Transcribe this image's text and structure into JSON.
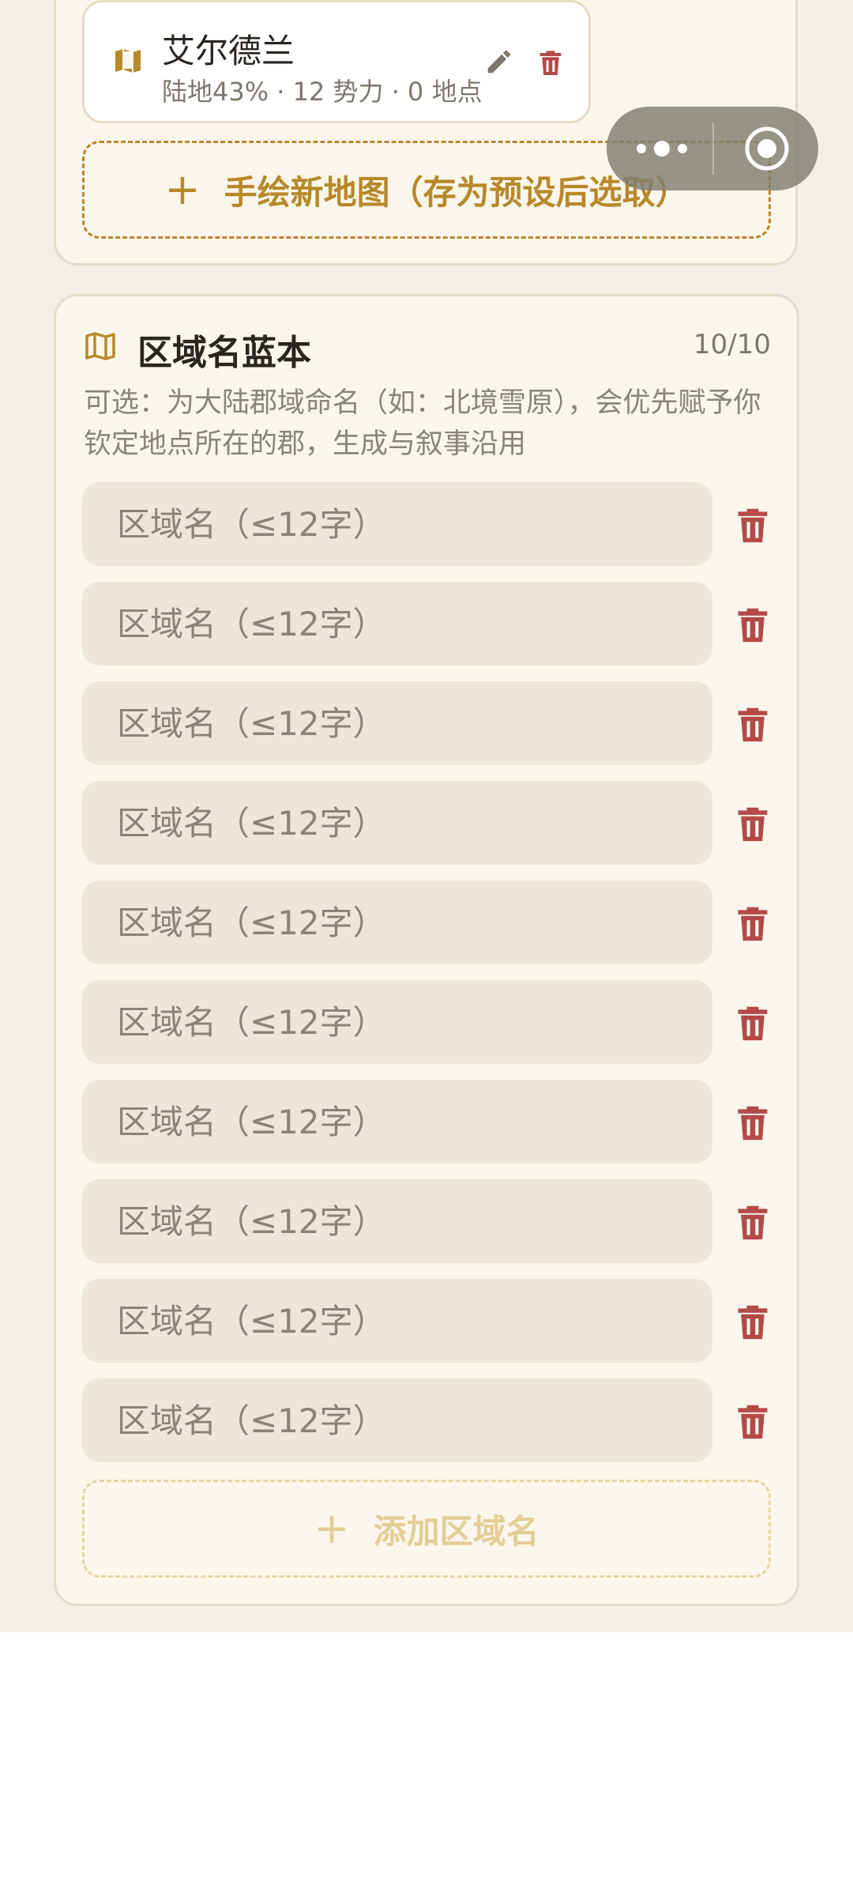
{
  "colors": {
    "accent": "#b8892a",
    "danger": "#b44a48",
    "card_bg": "#faf6ec",
    "input_bg": "#ede6da"
  },
  "map_item": {
    "icon": "map-icon",
    "name": "艾尔德兰",
    "meta": "陆地43% · 12 势力 · 0 地点",
    "edit_icon": "pencil-icon",
    "delete_icon": "trash-icon"
  },
  "draw_button": {
    "icon": "plus-icon",
    "label": "手绘新地图（存为预设后选取）"
  },
  "capsule": {
    "menu_icon": "more-dots-icon",
    "close_icon": "target-circle-icon"
  },
  "region_card": {
    "icon": "folded-map-icon",
    "title": "区域名蓝本",
    "count": "10/10",
    "description": "可选：为大陆郡域命名（如：北境雪原），会优先赋予你钦定地点所在的郡，生成与叙事沿用",
    "inputs": [
      {
        "value": "",
        "placeholder": "区域名（≤12字）"
      },
      {
        "value": "",
        "placeholder": "区域名（≤12字）"
      },
      {
        "value": "",
        "placeholder": "区域名（≤12字）"
      },
      {
        "value": "",
        "placeholder": "区域名（≤12字）"
      },
      {
        "value": "",
        "placeholder": "区域名（≤12字）"
      },
      {
        "value": "",
        "placeholder": "区域名（≤12字）"
      },
      {
        "value": "",
        "placeholder": "区域名（≤12字）"
      },
      {
        "value": "",
        "placeholder": "区域名（≤12字）"
      },
      {
        "value": "",
        "placeholder": "区域名（≤12字）"
      },
      {
        "value": "",
        "placeholder": "区域名（≤12字）"
      }
    ],
    "add_button": {
      "icon": "plus-icon",
      "label": "添加区域名"
    }
  }
}
